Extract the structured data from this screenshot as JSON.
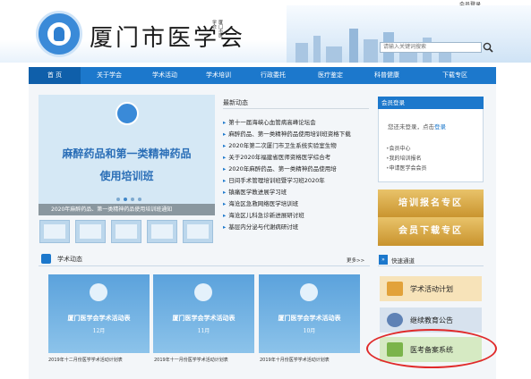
{
  "header": {
    "top_login": "会员登录",
    "site_title": "厦门市医学会",
    "seal_text": "厦门市医学会",
    "search_placeholder": "请输入关键词搜索"
  },
  "nav": [
    {
      "label": "首 页",
      "active": true
    },
    {
      "label": "关于学会"
    },
    {
      "label": "学术活动"
    },
    {
      "label": "学术培训"
    },
    {
      "label": "行政委托"
    },
    {
      "label": "医疗鉴定"
    },
    {
      "label": "科普健康"
    },
    {
      "label": "下载专区"
    }
  ],
  "slider": {
    "line1": "麻醉药品和第一类精神药品",
    "line2": "使用培训班",
    "caption": "2020年麻醉药品、第一类精神药品使用培训班通知"
  },
  "news": {
    "title": "最新动态",
    "items": [
      "第十一届海峡心血管病高峰论坛会",
      "麻醉药品、第一类精神药品使用培训班资格下载",
      "2020年第二次厦门市卫生系统实验室生物",
      "关于2020年福建省医师资格医学综合考",
      "2020年麻醉药品、第一类精神药品使用培",
      "日间手术管理培训班暨学习班2020年",
      "镇痛医学教进展学习班",
      "海沧区急救网络医学培训班",
      "海沧区儿科急诊新进展研讨班",
      "基层内分泌与代谢病研讨班"
    ]
  },
  "member": {
    "title": "会员登录",
    "status_prefix": "您还未登录，点击",
    "status_link": "登录",
    "links": [
      "会员中心",
      "我的培训报名",
      "申请医学会会员"
    ]
  },
  "promos": [
    "培训报名专区",
    "会员下载专区"
  ],
  "academic": {
    "title": "学术动态",
    "more": "更多>>",
    "posts": [
      {
        "main": "厦门医学会学术活动表",
        "sub": "12月",
        "caption": "2019年十二月份医学学术活动计划表"
      },
      {
        "main": "厦门医学会学术活动表",
        "sub": "11月",
        "caption": "2019年十一月份医学学术活动计划表"
      },
      {
        "main": "厦门医学会学术活动表",
        "sub": "10月",
        "caption": "2019年十月份医学学术活动计划表"
      }
    ]
  },
  "quick": {
    "title": "快速通道",
    "buttons": [
      {
        "label": "学术活动计划",
        "bg": "#f7e3b9",
        "icon_color": "#e2a23a"
      },
      {
        "label": "继续教育公告",
        "bg": "#d7e2ee",
        "icon_color": "#5f82b5"
      },
      {
        "label": "医考备案系统",
        "bg": "#d6eac3",
        "icon_color": "#7bb44a"
      }
    ]
  },
  "colors": {
    "nav_blue": "#1c78cc",
    "highlight_ring": "#e02a2a"
  }
}
